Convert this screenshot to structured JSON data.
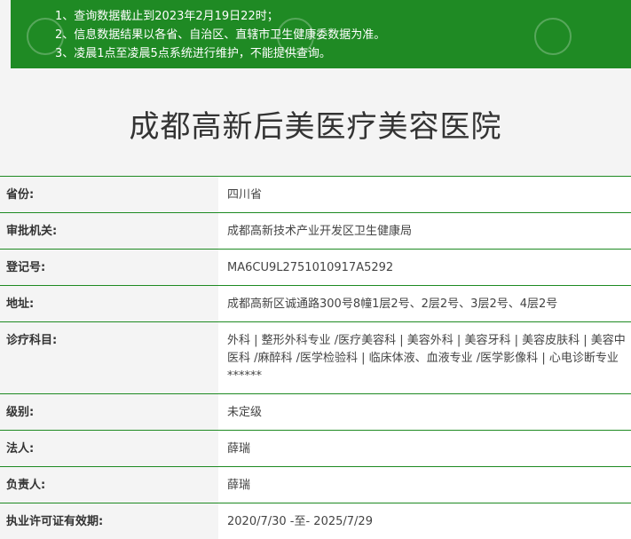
{
  "notice": {
    "lines": [
      "1、查询数据截止到2023年2月19日22时；",
      "2、信息数据结果以各省、自治区、直辖市卫生健康委数据为准。",
      "3、凌晨1点至凌晨5点系统进行维护，不能提供查询。"
    ]
  },
  "hospital": {
    "name": "成都高新后美医疗美容医院"
  },
  "details": [
    {
      "label": "省份:",
      "value": "四川省"
    },
    {
      "label": "审批机关:",
      "value": "成都高新技术产业开发区卫生健康局"
    },
    {
      "label": "登记号:",
      "value": "MA6CU9L2751010917A5292"
    },
    {
      "label": "地址:",
      "value": "成都高新区诚通路300号8幢1层2号、2层2号、3层2号、4层2号"
    },
    {
      "label": "诊疗科目:",
      "value": "外科 | 整形外科专业 /医疗美容科 | 美容外科 | 美容牙科 | 美容皮肤科 | 美容中医科 /麻醉科 /医学检验科 | 临床体液、血液专业 /医学影像科 | 心电诊断专业******"
    },
    {
      "label": "级别:",
      "value": "未定级"
    },
    {
      "label": "法人:",
      "value": "薛瑞"
    },
    {
      "label": "负责人:",
      "value": "薛瑞"
    },
    {
      "label": "执业许可证有效期:",
      "value": "2020/7/30 -至- 2025/7/29"
    }
  ],
  "colors": {
    "notice_bg": "#1f8a24",
    "border": "#1e8a22",
    "label_bg": "#f4f4f4",
    "value_bg": "#ffffff"
  }
}
